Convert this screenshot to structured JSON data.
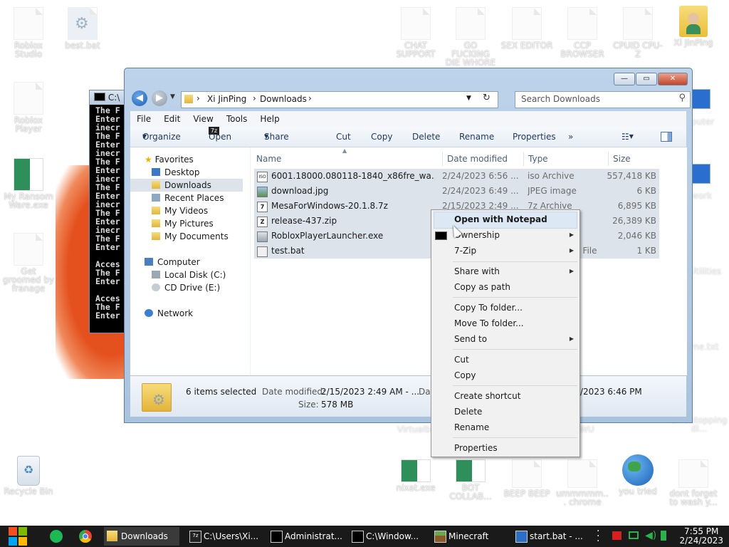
{
  "desktop_icons": [
    {
      "label": "Roblox Studio",
      "icon": "document-icon"
    },
    {
      "label": "best.bat",
      "icon": "gear-file-icon"
    },
    {
      "label": "Roblox Player",
      "icon": "document-icon"
    },
    {
      "label": "My Ransom Ware.exe",
      "icon": "green-exe-icon"
    },
    {
      "label": "Get groomed by franage",
      "icon": "document-icon"
    },
    {
      "label": "Recycle Bin",
      "icon": "recycle-bin-icon"
    },
    {
      "label": "CHAT SUPPORT",
      "icon": "document-icon"
    },
    {
      "label": "GO FUCKING DIE WHORE",
      "icon": "document-icon"
    },
    {
      "label": "SEX EDITOR",
      "icon": "document-icon"
    },
    {
      "label": "CCP BROWSER",
      "icon": "document-icon"
    },
    {
      "label": "CPUID CPU-Z",
      "icon": "document-icon"
    },
    {
      "label": "Xi JinPing",
      "icon": "user-folder-icon"
    },
    {
      "label": "nixat.exe",
      "icon": "green-exe-icon"
    },
    {
      "label": "BOT COLLAB...",
      "icon": "green-exe-icon"
    },
    {
      "label": "BEEP BEEP",
      "icon": "document-icon"
    },
    {
      "label": "ummmmm... chrome",
      "icon": "document-icon"
    },
    {
      "label": "you tried",
      "icon": "globe-icon"
    },
    {
      "label": "dont forget to wash y...",
      "icon": "document-icon"
    }
  ],
  "partial_right_labels": [
    "puter",
    "work",
    "Utilities",
    "me.txt",
    "aint stopping di..."
  ],
  "partial_behind_labels": [
    "Virtualbo",
    "WU"
  ],
  "cmd": {
    "title": "C:\\",
    "lines": [
      "The F",
      "Enter",
      "inecr",
      "The F",
      "Enter",
      "inecr",
      "The F",
      "Enter",
      "inecr",
      "The F",
      "Enter",
      "inecr",
      "The F",
      "Enter",
      "inecr",
      "The F",
      "Enter",
      "",
      "Acces",
      "The F",
      "Enter",
      "",
      "Acces",
      "The F",
      "Enter"
    ]
  },
  "explorer": {
    "breadcrumb": [
      "Xi JinPing",
      "Downloads"
    ],
    "search_placeholder": "Search Downloads",
    "menu": [
      "File",
      "Edit",
      "View",
      "Tools",
      "Help"
    ],
    "toolbar": {
      "organize": "Organize",
      "open": "Open",
      "share": "Share with",
      "cut": "Cut",
      "copy": "Copy",
      "delete": "Delete",
      "rename": "Rename",
      "properties": "Properties",
      "more": "»"
    },
    "nav": {
      "favorites": "Favorites",
      "desktop": "Desktop",
      "downloads": "Downloads",
      "recent": "Recent Places",
      "videos": "My Videos",
      "pictures": "My Pictures",
      "documents": "My Documents",
      "computer": "Computer",
      "local_disk": "Local Disk (C:)",
      "cd_drive": "CD Drive (E:)",
      "network": "Network"
    },
    "columns": [
      "Name",
      "Date modified",
      "Type",
      "Size"
    ],
    "files": [
      {
        "name": "6001.18000.080118-1840_x86fre_wa...",
        "date": "2/24/2023 6:56 ...",
        "type": "iso Archive",
        "size": "557,418 KB"
      },
      {
        "name": "download.jpg",
        "date": "2/24/2023 6:49 ...",
        "type": "JPEG image",
        "size": "6 KB"
      },
      {
        "name": "MesaForWindows-20.1.8.7z",
        "date": "2/15/2023 2:49 ...",
        "type": "7z Archive",
        "size": "6,895 KB"
      },
      {
        "name": "release-437.zip",
        "date": "",
        "type": "",
        "size": "26,389 KB"
      },
      {
        "name": "RobloxPlayerLauncher.exe",
        "date": "",
        "type": "",
        "size": "2,046 KB"
      },
      {
        "name": "test.bat",
        "date": "",
        "type": "h File",
        "size": "1 KB"
      }
    ],
    "details": {
      "selected": "6 items selected",
      "date_label": "Date modified:",
      "date_value": "2/15/2023 2:49 AM - ...",
      "da": "Da",
      "size_label": "Size:",
      "size_value": "578 MB",
      "date_right": "/2023 6:46 PM"
    }
  },
  "context_menu": {
    "open_notepad": "Open with Notepad",
    "ownership": "Ownership",
    "zip": "7-Zip",
    "share": "Share with",
    "copy_path": "Copy as path",
    "copy_to": "Copy To folder...",
    "move_to": "Move To folder...",
    "send_to": "Send to",
    "cut": "Cut",
    "copy": "Copy",
    "shortcut": "Create shortcut",
    "delete": "Delete",
    "rename": "Rename",
    "properties": "Properties"
  },
  "taskbar": {
    "items": [
      "Downloads",
      "C:\\Users\\Xi...",
      "Administrat...",
      "C:\\Window...",
      "Minecraft",
      "start.bat - ..."
    ],
    "time": "7:55 PM",
    "date": "2/24/2023"
  },
  "colors": {
    "accent": "#3d7fcf",
    "taskbar": "#1a1a1a",
    "selection": "#dde3ea"
  }
}
